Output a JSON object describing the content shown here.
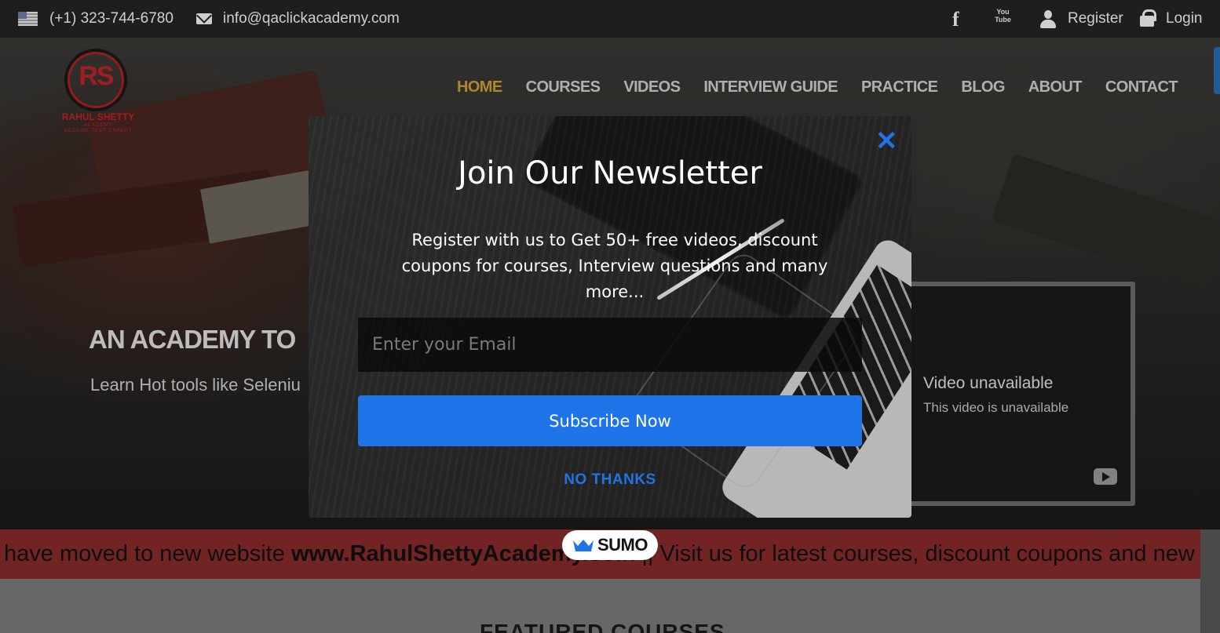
{
  "topbar": {
    "phone": "(+1) 323-744-6780",
    "email": "info@qaclickacademy.com",
    "facebook_glyph": "f",
    "youtube_glyph_top": "You",
    "youtube_glyph_bottom": "Tube",
    "register": "Register",
    "login": "Login"
  },
  "logo": {
    "mark": "RS",
    "name": "RAHUL SHETTY",
    "academy": "ACADEMY",
    "tagline": "BECOME TEST EXPERT"
  },
  "nav": {
    "items": [
      "HOME",
      "COURSES",
      "VIDEOS",
      "INTERVIEW GUIDE",
      "PRACTICE",
      "BLOG",
      "ABOUT",
      "CONTACT"
    ],
    "active_index": 0
  },
  "hero": {
    "title": "AN ACADEMY TO",
    "subtitle": "Learn Hot tools like Seleniu"
  },
  "video": {
    "unavailable_title": "Video unavailable",
    "unavailable_text": "This video is unavailable"
  },
  "modal": {
    "close_glyph": "✕",
    "title": "Join Our Newsletter",
    "description": "Register with us to Get 50+ free videos, discount coupons for courses, Interview questions and many more...",
    "email_placeholder": "Enter your Email",
    "subscribe_label": "Subscribe Now",
    "no_thanks_label": "NO THANKS"
  },
  "banner": {
    "text_before": "have moved to new website ",
    "link": "www.RahulShettyAcademy.com",
    "text_after": " || Visit us for latest courses, discount coupons and new"
  },
  "sumo": {
    "label": "SUMO"
  },
  "featured": {
    "title": "FEATURED COURSES"
  },
  "colors": {
    "accent_blue": "#1e74e8",
    "nav_active": "#d4a53a",
    "banner_red": "#8c2c2c",
    "logo_red": "#c4242a"
  }
}
